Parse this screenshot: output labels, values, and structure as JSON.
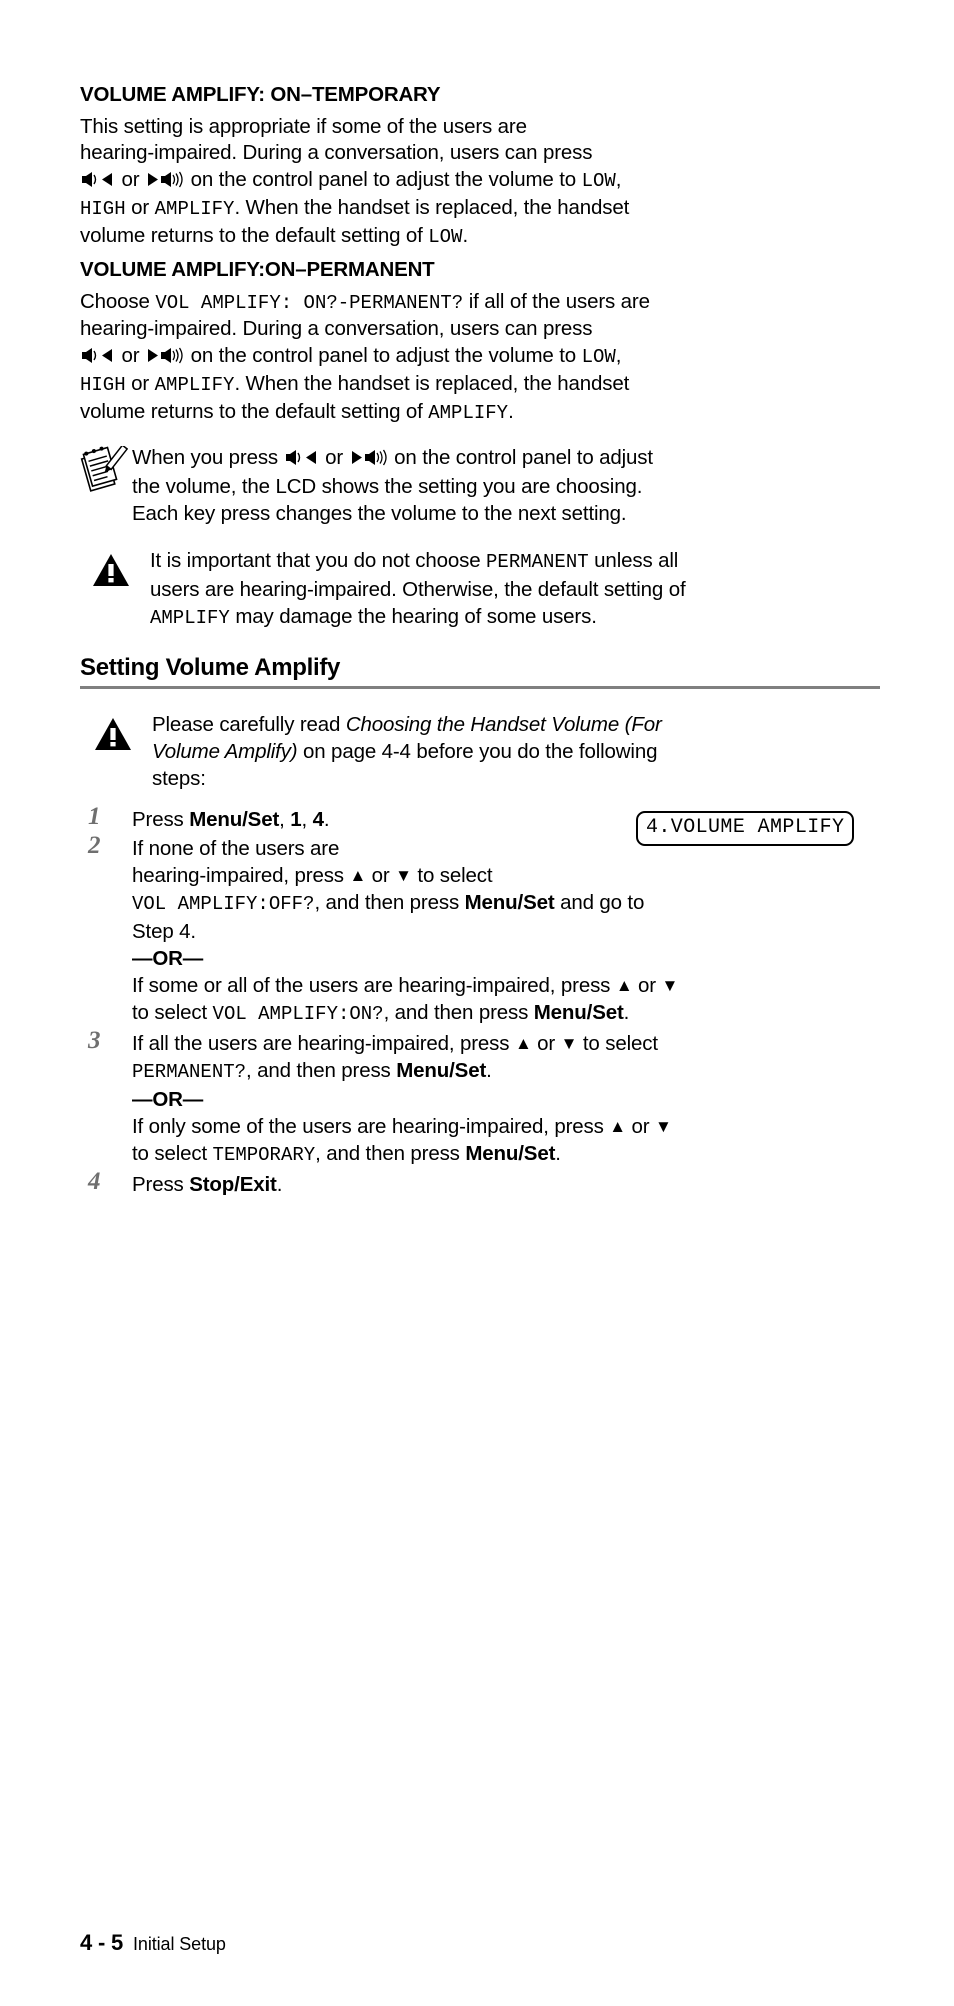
{
  "page": {
    "footer_page_number": "4 - 5",
    "footer_chapter": "Initial Setup"
  },
  "sections": {
    "temporary": {
      "heading": "VOLUME AMPLIFY: ON–TEMPORARY",
      "para_line1": "This setting is appropriate if some of the users are",
      "para_line2": "hearing-impaired. During a conversation, users can press",
      "line3_prefix": "",
      "line3_mid": " or ",
      "line3_suffix": " on the control panel to adjust the volume to ",
      "code_low": "LOW",
      "line4_code_high": "HIGH",
      "line4_or": " or ",
      "line4_code_amplify": "AMPLIFY",
      "line4_tail": ". When the handset is replaced, the handset",
      "line5_prefix": "volume returns to the default setting of ",
      "line5_code": "LOW",
      "line5_tail": "."
    },
    "permanent": {
      "heading": "VOLUME AMPLIFY:ON–PERMANENT",
      "choose_prefix": "Choose ",
      "choose_code": "VOL AMPLIFY: ON?-PERMANENT?",
      "choose_tail": " if all of the users are",
      "para_line2": "hearing-impaired. During a conversation, users can press",
      "line3_mid": " or ",
      "line3_suffix": " on the control panel to adjust the volume to ",
      "code_low": "LOW",
      "line4_code_high": "HIGH",
      "line4_or": " or ",
      "line4_code_amplify": "AMPLIFY",
      "line4_tail": ". When the handset is replaced, the handset",
      "line5_prefix": "volume returns to the default setting of ",
      "line5_code": "AMPLIFY",
      "line5_tail": "."
    }
  },
  "note": {
    "icon": "notepad-pencil-icon",
    "line1_prefix": "When you press ",
    "line1_mid": " or ",
    "line1_suffix": " on the control panel to adjust",
    "line2": "the volume, the LCD shows the setting you are choosing.",
    "line3": "Each key press changes the volume to the next setting."
  },
  "warning_top": {
    "icon": "warning-triangle-icon",
    "line1_prefix": "It is important that you do not choose ",
    "line1_code": "PERMANENT",
    "line1_tail": " unless all",
    "line2": "users are hearing-impaired. Otherwise, the default setting of",
    "line3_code": "AMPLIFY",
    "line3_tail": " may damage the hearing of some users."
  },
  "setting_section": {
    "heading": "Setting Volume Amplify",
    "warning": {
      "icon": "warning-triangle-icon",
      "line1_prefix": "Please carefully read ",
      "line1_italic": "Choosing the Handset Volume (For",
      "line2_italic": "Volume Amplify)",
      "line2_tail": " on page 4-4 before you do the following",
      "line3": "steps:"
    },
    "lcd": {
      "text": "4.VOLUME AMPLIFY"
    },
    "steps": [
      {
        "number": "1",
        "segments": {
          "prefix": "Press ",
          "bold1": "Menu/Set",
          "mid1": ", ",
          "bold2": "1",
          "mid2": ", ",
          "bold3": "4",
          "tail": "."
        }
      },
      {
        "number": "2",
        "line1": "If none of the users are",
        "line2_prefix": "hearing-impaired, press ",
        "line2_up": "▲",
        "line2_or": " or ",
        "line2_dn": "▼",
        "line2_tail": " to select",
        "line3_code": "VOL AMPLIFY:OFF?",
        "line3_mid": ", and then press ",
        "line3_bold": "Menu/Set",
        "line3_tail": " and go to",
        "line4": "Step 4.",
        "or_label": "—OR—",
        "alt_line1_prefix": "If some or all of the users are hearing-impaired, press ",
        "alt_line1_up": "▲",
        "alt_line1_or": " or ",
        "alt_line1_dn": "▼",
        "alt_line2_prefix": "to select ",
        "alt_line2_code": "VOL AMPLIFY:ON?",
        "alt_line2_mid": ", and then press ",
        "alt_line2_bold": "Menu/Set",
        "alt_line2_tail": "."
      },
      {
        "number": "3",
        "line1_prefix": "If all the users are hearing-impaired, press ",
        "line1_up": "▲",
        "line1_or": " or ",
        "line1_dn": "▼",
        "line1_tail": " to select",
        "line2_code": "PERMANENT?",
        "line2_mid": ", and then press ",
        "line2_bold": "Menu/Set",
        "line2_tail": ".",
        "or_label": "—OR—",
        "alt_line1_prefix": "If only some of the users are hearing-impaired, press ",
        "alt_line1_up": "▲",
        "alt_line1_or": " or ",
        "alt_line1_dn": "▼",
        "alt_line2_prefix": "to select ",
        "alt_line2_code": "TEMPORARY",
        "alt_line2_mid": ", and then press ",
        "alt_line2_bold": "Menu/Set",
        "alt_line2_tail": "."
      },
      {
        "number": "4",
        "segments": {
          "prefix": "Press ",
          "bold1": "Stop/Exit",
          "tail": "."
        }
      }
    ]
  },
  "colors": {
    "text": "#000000",
    "rule": "#808080",
    "step_number": "#6f6f6f",
    "background": "#ffffff"
  }
}
